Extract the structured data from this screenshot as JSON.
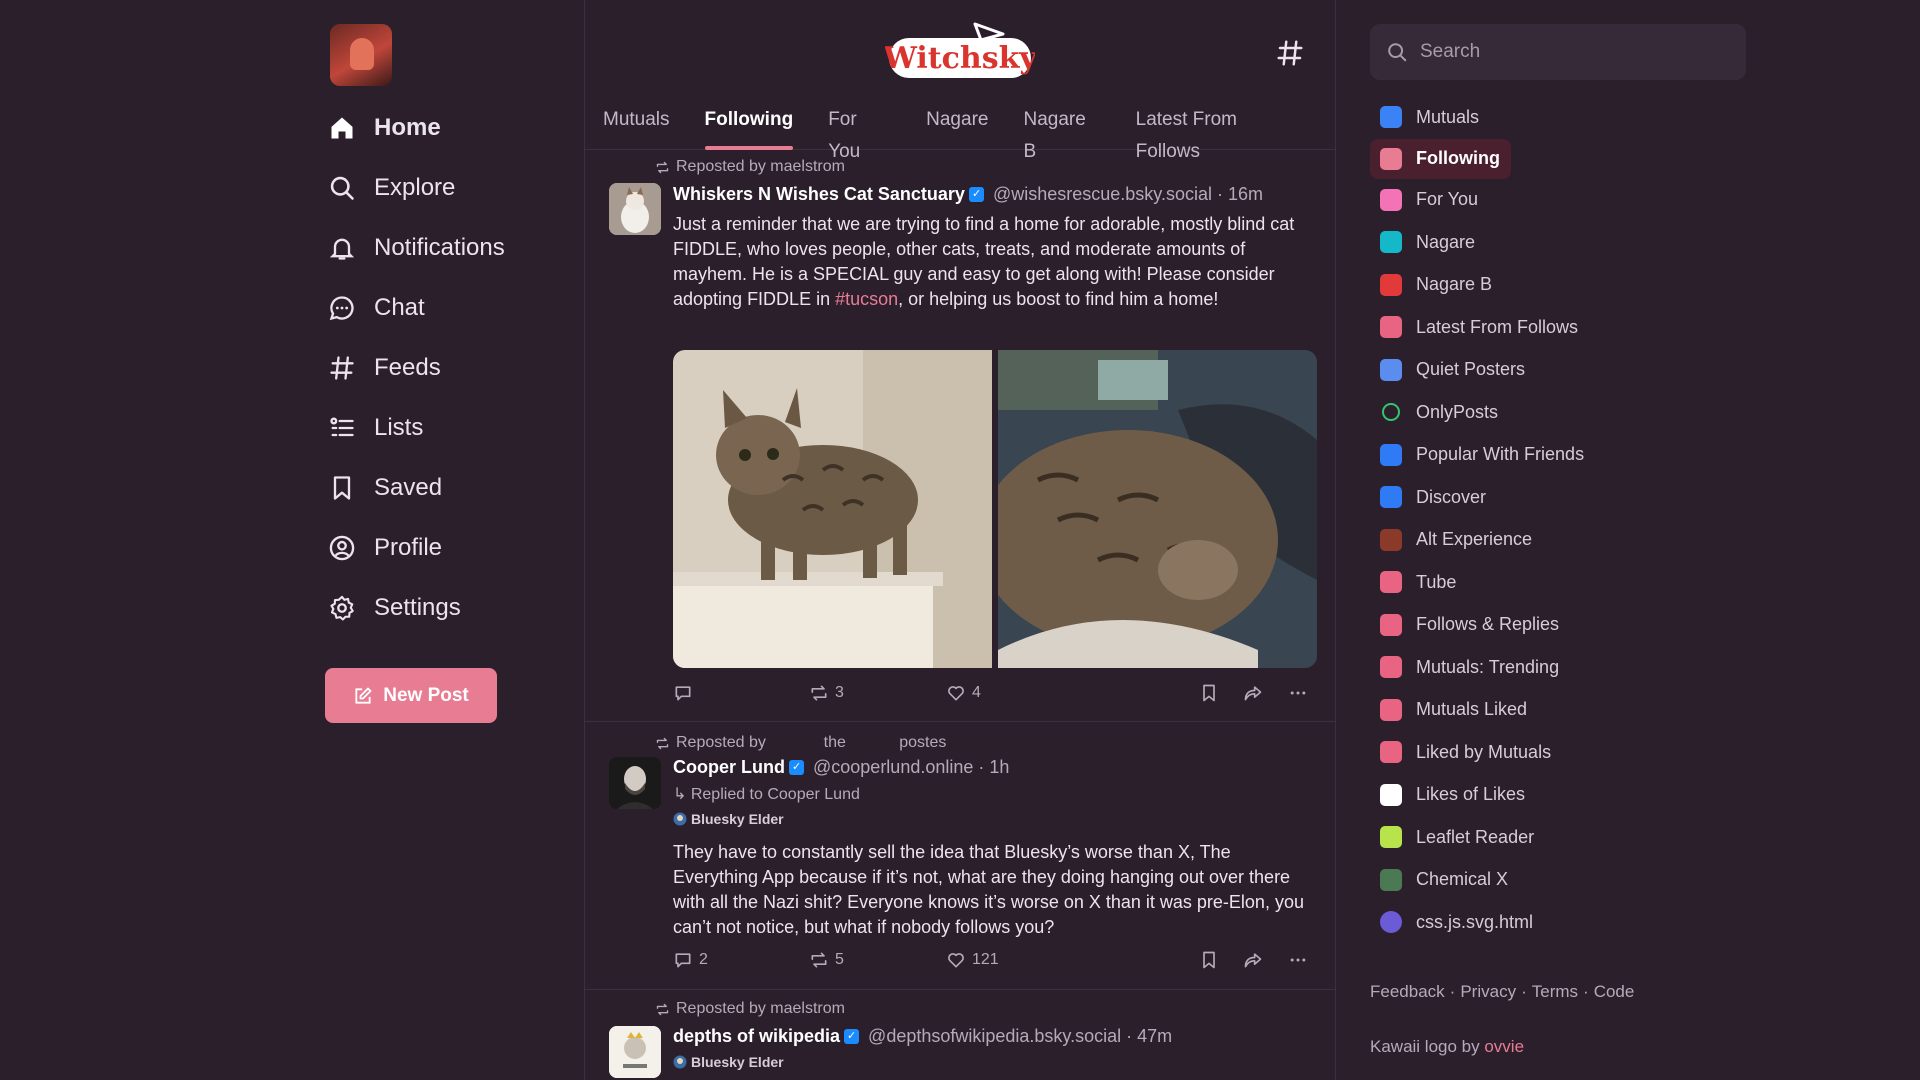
{
  "nav": {
    "items": [
      {
        "label": "Home",
        "icon": "home-icon",
        "active": true
      },
      {
        "label": "Explore",
        "icon": "search-icon"
      },
      {
        "label": "Notifications",
        "icon": "bell-icon"
      },
      {
        "label": "Chat",
        "icon": "chat-icon"
      },
      {
        "label": "Feeds",
        "icon": "hash-icon"
      },
      {
        "label": "Lists",
        "icon": "list-icon"
      },
      {
        "label": "Saved",
        "icon": "bookmark-icon"
      },
      {
        "label": "Profile",
        "icon": "profile-icon"
      },
      {
        "label": "Settings",
        "icon": "gear-icon"
      }
    ],
    "new_post_label": "New Post"
  },
  "header": {
    "logo_text": "Witchsky"
  },
  "tabs": [
    {
      "label": "Mutuals"
    },
    {
      "label": "Following",
      "active": true
    },
    {
      "label": "For You"
    },
    {
      "label": "Nagare"
    },
    {
      "label": "Nagare B"
    },
    {
      "label": "Latest From Follows"
    }
  ],
  "posts": [
    {
      "repost_by": "Reposted by maelstrom",
      "name": "Whiskers N Wishes Cat Sanctuary",
      "handle": "@wishesrescue.bsky.social",
      "time": "· 16m",
      "text_before": "Just a reminder that we are trying to find a home for adorable, mostly blind cat FIDDLE, who loves people, other cats, treats, and moderate amounts of mayhem. He is a SPECIAL guy and easy to get along with! Please consider adopting FIDDLE in ",
      "hashtag": "#tucson",
      "text_after": ", or helping us boost to find him a home!",
      "replies": "",
      "reposts": "3",
      "likes": "4"
    },
    {
      "repost_by": "Reposted by             the            postes",
      "name": "Cooper Lund",
      "handle": "@cooperlund.online",
      "time": "· 1h",
      "reply_to": "↳ Replied to Cooper Lund",
      "badge": "Bluesky Elder",
      "text": "They have to constantly sell the idea that Bluesky’s worse than X, The Everything App because if it’s not, what are they doing hanging out over there with all the Nazi shit? Everyone knows it’s worse on X than it was pre-Elon, you can’t not notice, but what if nobody  follows you?",
      "replies": "2",
      "reposts": "5",
      "likes": "121"
    },
    {
      "repost_by": "Reposted by maelstrom",
      "name": "depths of wikipedia",
      "handle": "@depthsofwikipedia.bsky.social",
      "time": "· 47m",
      "badge": "Bluesky Elder"
    }
  ],
  "search": {
    "placeholder": "Search"
  },
  "feeds": [
    {
      "label": "Mutuals",
      "color": "#3b82f6"
    },
    {
      "label": "Following",
      "color": "#e77c93",
      "active": true
    },
    {
      "label": "For You",
      "color": "#f472b6"
    },
    {
      "label": "Nagare",
      "color": "#14b8c8"
    },
    {
      "label": "Nagare B",
      "color": "#e23a3a"
    },
    {
      "label": "Latest From Follows",
      "color": "#e86482"
    },
    {
      "label": "Quiet Posters",
      "color": "#5b8def"
    },
    {
      "label": "OnlyPosts",
      "color": "#33c46f",
      "ring": true
    },
    {
      "label": "Popular With Friends",
      "color": "#2f7bf5"
    },
    {
      "label": "Discover",
      "color": "#2f7bf5"
    },
    {
      "label": "Alt Experience",
      "color": "#8b3a2a"
    },
    {
      "label": "Tube",
      "color": "#e86482"
    },
    {
      "label": "Follows & Replies",
      "color": "#e86482"
    },
    {
      "label": "Mutuals: Trending",
      "color": "#e86482"
    },
    {
      "label": "Mutuals Liked",
      "color": "#e86482"
    },
    {
      "label": "Liked by Mutuals",
      "color": "#e86482"
    },
    {
      "label": "Likes of Likes",
      "color": "#ffffff",
      "frame": true
    },
    {
      "label": "Leaflet Reader",
      "color": "#b9e34a"
    },
    {
      "label": "Chemical X",
      "color": "#4b7a52"
    },
    {
      "label": "css.js.svg.html",
      "color": "#6b5bd6"
    }
  ],
  "footer": {
    "links": [
      "Feedback",
      "Privacy",
      "Terms",
      "Code"
    ],
    "credit_prefix": "Kawaii logo by ",
    "credit_name": "ovvie"
  },
  "colors": {
    "background": "#2b1f2c",
    "accent": "#e77c93",
    "muted_text": "#b9a9b8"
  }
}
